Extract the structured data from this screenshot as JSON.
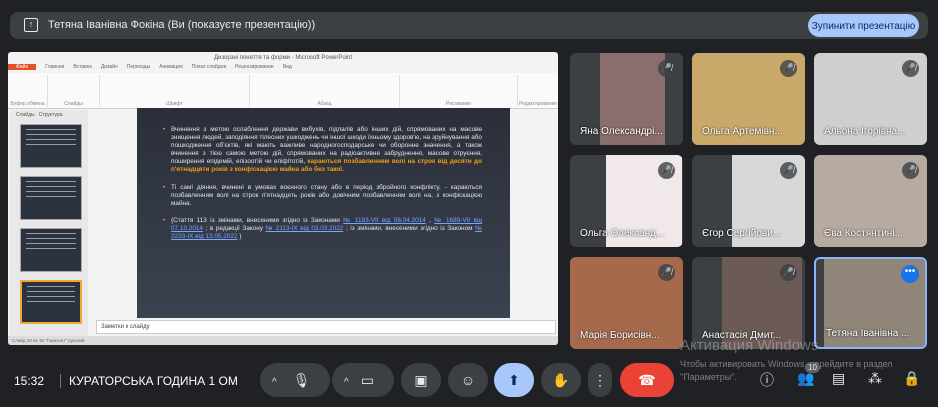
{
  "banner": {
    "text": "Тетяна Іванівна Фокіна (Ви (показуєте презентацію))",
    "stop_label": "Зупинити презентацію"
  },
  "ppt": {
    "window_title": "Дизорзні поняття та форми - Microsoft PowerPoint",
    "tabs": [
      "Файл",
      "Главная",
      "Вставка",
      "Дизайн",
      "Переходы",
      "Анимация",
      "Показ слайдов",
      "Рецензирование",
      "Вид"
    ],
    "groups": [
      "Буфер обмена",
      "Слайды",
      "Шрифт",
      "Абзац",
      "Рисование",
      "Редактирование"
    ],
    "pane_tabs": [
      "Слайды",
      "Структура"
    ],
    "slide": {
      "b1": "Вчинення з метою ослаблення держави вибухів, підпалів або інших дій, спрямованих на масове знищення людей, заподіяння тілесних ушкоджень чи іншої шкоди їхньому здоров'ю, на зруйнування або пошкодження об'єктів, які мають важливе народногосподарське чи оборонне значення, а також вчинення з тією самою метою дій, спрямованих на радіоактивне забруднення, масове отруєння, поширення епідемій, епізоотій чи епіфітотій,",
      "b1_hl": "караються позбавленням волі на строк від десяти до п'ятнадцяти років з конфіскацією майна або без такої.",
      "b2": "Ті самі діяння, вчинені в умовах воєнного стану або в період збройного конфлікту, - караються позбавленням волі на строк п'ятнадцять років або довічним позбавленням волі на, з конфіскацією майна.",
      "b3_a": "{Стаття 113 із змінами, внесеними згідно із Законами",
      "b3_l1": "№ 1183-VII від 08.04.2014",
      "b3_l2": "№ 1689-VII від 07.10.2014",
      "b3_b": "; в редакції Закону",
      "b3_l3": "№ 2113-IX від 03.03.2022",
      "b3_c": "; із змінами, внесеними згідно із Законом",
      "b3_l4": "№ 2233-IX від 13.05.2022",
      "b3_d": "}"
    },
    "notes": "Заметки к слайду",
    "status": "Слайд 10 из 15   \"Горизонт\"   русский"
  },
  "participants": [
    {
      "name": "Яна Олександрі...",
      "muted": true
    },
    {
      "name": "Ольга Артемівн...",
      "muted": true
    },
    {
      "name": "Альона Ігорівна...",
      "muted": true
    },
    {
      "name": "Ольга Олександ...",
      "muted": true
    },
    {
      "name": "Єгор Сергійови...",
      "muted": true
    },
    {
      "name": "Єва Костянтині...",
      "muted": true
    },
    {
      "name": "Марія Борисівн...",
      "muted": true
    },
    {
      "name": "Анастасія Дмит...",
      "muted": true
    },
    {
      "name": "Тетяна Іванівна ...",
      "muted": false,
      "self": true
    }
  ],
  "bottom": {
    "time": "15:32",
    "meeting": "КУРАТОРСЬКА ГОДИНА 1 ОМ",
    "people_count": "10"
  },
  "watermark": {
    "title": "Активация Windows",
    "text": "Чтобы активировать Windows, перейдите в раздел \"Параметры\"."
  },
  "colors": {
    "accent": "#a8c7fa",
    "end_call": "#ea4335",
    "bg": "#202124"
  }
}
